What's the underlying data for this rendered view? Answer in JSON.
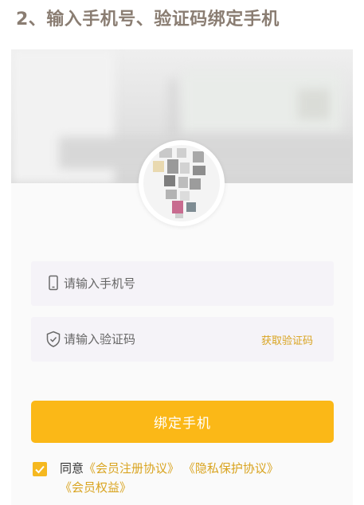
{
  "step_title": "2、输入手机号、验证码绑定手机",
  "form": {
    "phone_placeholder": "请输入手机号",
    "code_placeholder": "请输入验证码",
    "get_code_label": "获取验证码",
    "submit_label": "绑定手机"
  },
  "agreement": {
    "prefix": "同意",
    "links": [
      "《会员注册协议》",
      "《隐私保护协议》",
      "《会员权益》"
    ],
    "checked": true
  },
  "colors": {
    "accent": "#fbb817",
    "link": "#d9a420",
    "field_bg": "#f5f3f8",
    "title": "#8a7d72"
  },
  "icons": {
    "phone_field": "phone-icon",
    "code_field": "shield-check-icon",
    "checkbox": "checkmark-icon"
  }
}
